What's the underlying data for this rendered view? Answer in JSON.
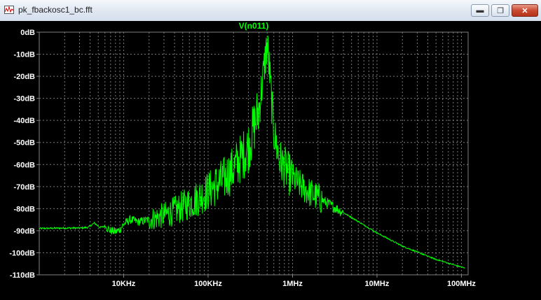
{
  "window": {
    "title": "pk_fbackosc1_bc.fft"
  },
  "chart_data": {
    "type": "line",
    "title": "V(n011)",
    "x_scale": "log",
    "xlim": [
      1000,
      120000000
    ],
    "ylim": [
      -110,
      0
    ],
    "grid": true,
    "x_ticks": [
      {
        "value": 10000,
        "label": "10KHz"
      },
      {
        "value": 100000,
        "label": "100KHz"
      },
      {
        "value": 1000000,
        "label": "1MHz"
      },
      {
        "value": 10000000,
        "label": "10MHz"
      },
      {
        "value": 100000000,
        "label": "100MHz"
      }
    ],
    "y_ticks": [
      {
        "value": 0,
        "label": "0dB"
      },
      {
        "value": -10,
        "label": "-10dB"
      },
      {
        "value": -20,
        "label": "-20dB"
      },
      {
        "value": -30,
        "label": "-30dB"
      },
      {
        "value": -40,
        "label": "-40dB"
      },
      {
        "value": -50,
        "label": "-50dB"
      },
      {
        "value": -60,
        "label": "-60dB"
      },
      {
        "value": -70,
        "label": "-70dB"
      },
      {
        "value": -80,
        "label": "-80dB"
      },
      {
        "value": -90,
        "label": "-90dB"
      },
      {
        "value": -100,
        "label": "-100dB"
      },
      {
        "value": -110,
        "label": "-110dB"
      }
    ],
    "series": [
      {
        "name": "V(n011)",
        "color": "#00ff00",
        "x": [
          1000,
          2000,
          3000,
          3800,
          4500,
          5200,
          6000,
          7000,
          8000,
          9000,
          10000,
          12000,
          15000,
          20000,
          25000,
          30000,
          40000,
          50000,
          70000,
          100000,
          150000,
          200000,
          300000,
          400000,
          450000,
          480000,
          500000,
          520000,
          550000,
          600000,
          700000,
          900000,
          1000000,
          1200000,
          1500000,
          2000000,
          3000000,
          5000000,
          10000000,
          20000000,
          50000000,
          110000000
        ],
        "y": [
          -89,
          -88.8,
          -88.8,
          -88.5,
          -86.5,
          -88.5,
          -88,
          -90,
          -90.5,
          -89.5,
          -87,
          -85,
          -86,
          -85,
          -84,
          -83,
          -81,
          -79,
          -76,
          -72,
          -67,
          -62,
          -52,
          -35,
          -20,
          -10,
          -6,
          -12,
          -25,
          -45,
          -58,
          -64,
          -66,
          -69,
          -72,
          -75,
          -79,
          -84,
          -91,
          -97,
          -103,
          -107
        ]
      }
    ]
  }
}
